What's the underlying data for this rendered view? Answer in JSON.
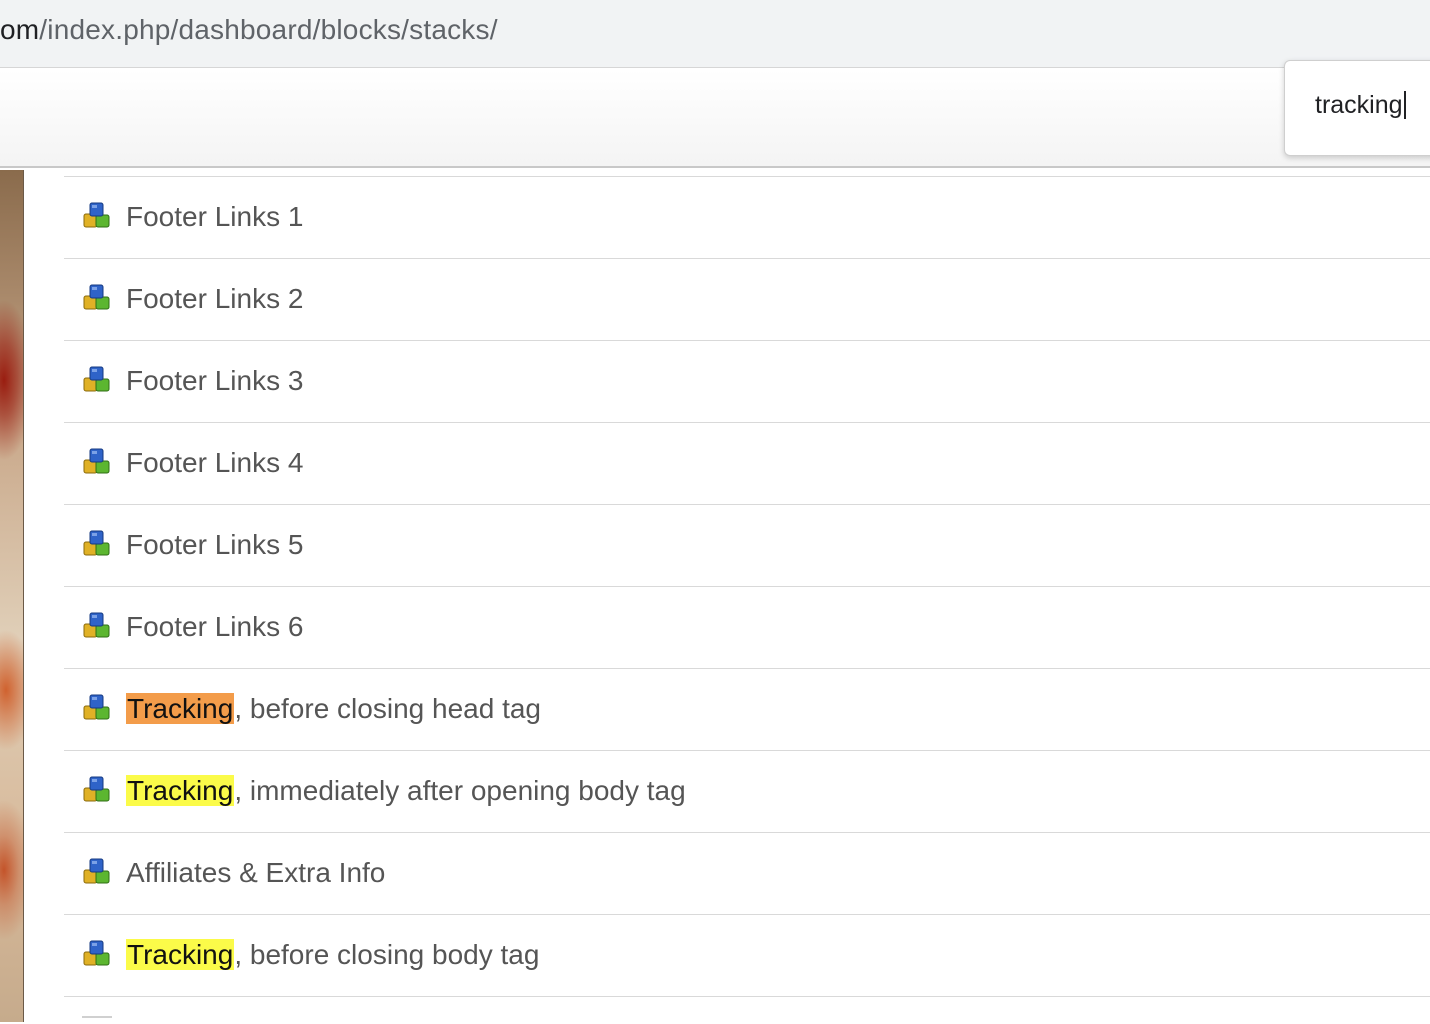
{
  "browser": {
    "url_host": "om",
    "url_path": "/index.php/dashboard/blocks/stacks/"
  },
  "find_bar": {
    "query": "tracking"
  },
  "stacks": {
    "items": [
      {
        "highlight": "",
        "label": "Footer Links 1",
        "highlight_state": "none"
      },
      {
        "highlight": "",
        "label": "Footer Links 2",
        "highlight_state": "none"
      },
      {
        "highlight": "",
        "label": "Footer Links 3",
        "highlight_state": "none"
      },
      {
        "highlight": "",
        "label": "Footer Links 4",
        "highlight_state": "none"
      },
      {
        "highlight": "",
        "label": "Footer Links 5",
        "highlight_state": "none"
      },
      {
        "highlight": "",
        "label": "Footer Links 6",
        "highlight_state": "none"
      },
      {
        "highlight": "Tracking",
        "label": ", before closing head tag",
        "highlight_state": "current"
      },
      {
        "highlight": "Tracking",
        "label": ", immediately after opening body tag",
        "highlight_state": "match"
      },
      {
        "highlight": "",
        "label": "Affiliates & Extra Info",
        "highlight_state": "none"
      },
      {
        "highlight": "Tracking",
        "label": ", before closing body tag",
        "highlight_state": "match"
      }
    ]
  },
  "colors": {
    "current_match": "#f39c4a",
    "other_match": "#fbfb49",
    "item_text": "#555555"
  },
  "icons": {
    "stack": "stack-blocks-icon"
  }
}
